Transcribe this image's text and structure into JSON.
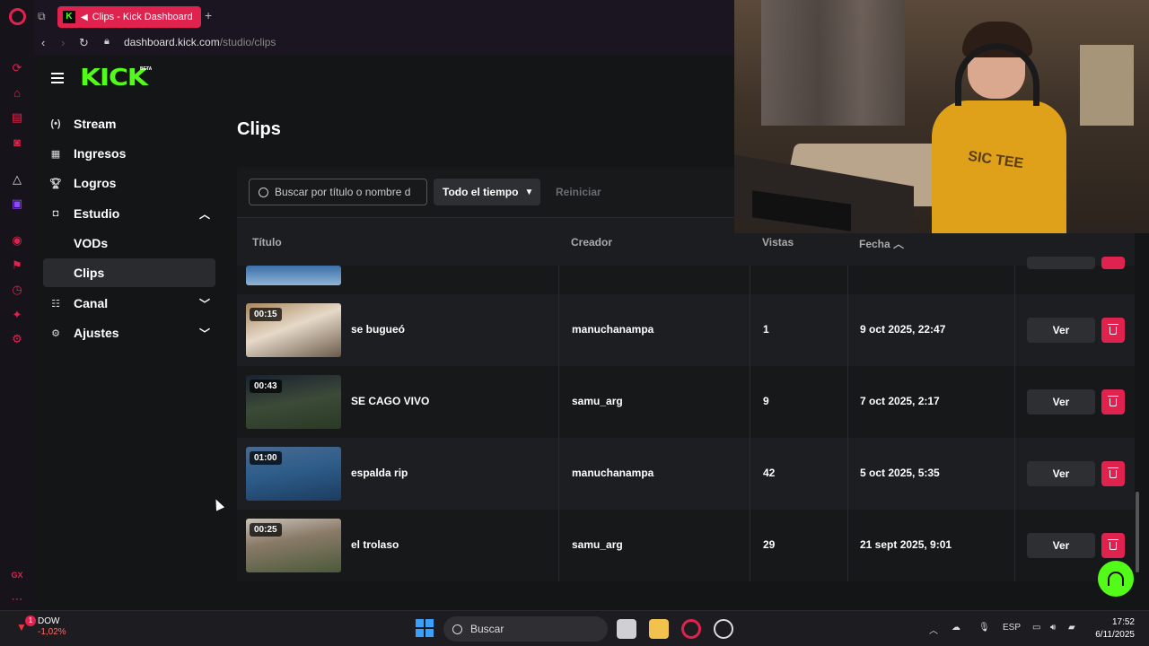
{
  "browser": {
    "tab_title": "Clips - Kick Dashboard",
    "url_domain": "dashboard.kick.com",
    "url_path": "/studio/clips",
    "accent": "#e0234e"
  },
  "kick": {
    "logo": "KICK",
    "logo_badge": "BETA",
    "brand_color": "#53fc18",
    "sidebar": [
      {
        "label": "Stream",
        "icon": "broadcast-icon"
      },
      {
        "label": "Ingresos",
        "icon": "revenue-icon"
      },
      {
        "label": "Logros",
        "icon": "trophy-icon"
      },
      {
        "label": "Estudio",
        "icon": "studio-icon",
        "expanded": true
      },
      {
        "label": "VODs"
      },
      {
        "label": "Clips",
        "active": true
      },
      {
        "label": "Canal",
        "icon": "channel-icon"
      },
      {
        "label": "Ajustes",
        "icon": "gear-icon"
      }
    ],
    "page_title": "Clips",
    "filters": {
      "search_placeholder": "Buscar por título o nombre d",
      "time_filter": "Todo el tiempo",
      "reset": "Reiniciar"
    },
    "table": {
      "headers": {
        "title": "Título",
        "creator": "Creador",
        "views": "Vistas",
        "date": "Fecha"
      },
      "sort": "date-ascending",
      "rows": [
        {
          "duration": "00:15",
          "title": "se bugueó",
          "creator": "manuchanampa",
          "views": "1",
          "date": "9 oct 2025, 22:47",
          "view_btn": "Ver"
        },
        {
          "duration": "00:43",
          "title": "SE CAGO VIVO",
          "creator": "samu_arg",
          "views": "9",
          "date": "7 oct 2025, 2:17",
          "view_btn": "Ver"
        },
        {
          "duration": "01:00",
          "title": "espalda rip",
          "creator": "manuchanampa",
          "views": "42",
          "date": "5 oct 2025, 5:35",
          "view_btn": "Ver"
        },
        {
          "duration": "00:25",
          "title": "el trolaso",
          "creator": "samu_arg",
          "views": "29",
          "date": "21 sept 2025, 9:01",
          "view_btn": "Ver"
        }
      ]
    }
  },
  "taskbar": {
    "stock_name": "DOW",
    "stock_change": "-1,02%",
    "stock_badge": "1",
    "search": "Buscar",
    "lang": "ESP",
    "time": "17:52",
    "date": "6/11/2025"
  },
  "webcam": {
    "shirt_text": "SIC TEE"
  },
  "sidebar_bottom_label": "GX"
}
